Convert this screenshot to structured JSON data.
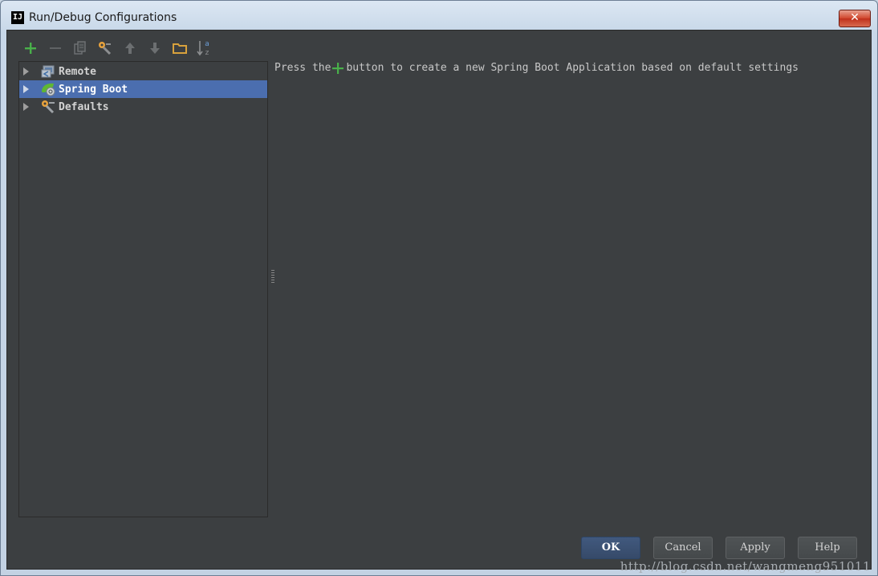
{
  "window": {
    "title": "Run/Debug Configurations",
    "app_icon_text": "IJ",
    "close_symbol": "✕"
  },
  "toolbar": {
    "items": [
      {
        "name": "add-configuration",
        "icon": "plus-icon"
      },
      {
        "name": "remove-configuration",
        "icon": "minus-icon"
      },
      {
        "name": "copy-configuration",
        "icon": "copy-icon"
      },
      {
        "name": "edit-defaults",
        "icon": "wrench-icon"
      },
      {
        "name": "move-up",
        "icon": "arrow-up-icon"
      },
      {
        "name": "move-down",
        "icon": "arrow-down-icon"
      },
      {
        "name": "create-folder",
        "icon": "folder-icon"
      },
      {
        "name": "sort-configurations",
        "icon": "sort-az-icon"
      }
    ],
    "sort_icon_text": {
      "top": "a",
      "bottom": "z"
    }
  },
  "tree": {
    "items": [
      {
        "label": "Remote",
        "icon": "remote-icon",
        "selected": false
      },
      {
        "label": "Spring Boot",
        "icon": "spring-boot-icon",
        "selected": true
      },
      {
        "label": "Defaults",
        "icon": "defaults-wrench-icon",
        "selected": false
      }
    ]
  },
  "hint": {
    "prefix": "Press the",
    "suffix": "button to create a new Spring Boot Application based on default settings"
  },
  "buttons": {
    "ok": "OK",
    "cancel": "Cancel",
    "apply": "Apply",
    "help": "Help"
  },
  "watermark": "http://blog.csdn.net/wangmeng951011",
  "colors": {
    "background": "#3c3f41",
    "selection": "#4b6eaf",
    "add_green": "#49b04a",
    "icon_orange": "#e8a33d",
    "icon_gray": "#8d8f91"
  }
}
